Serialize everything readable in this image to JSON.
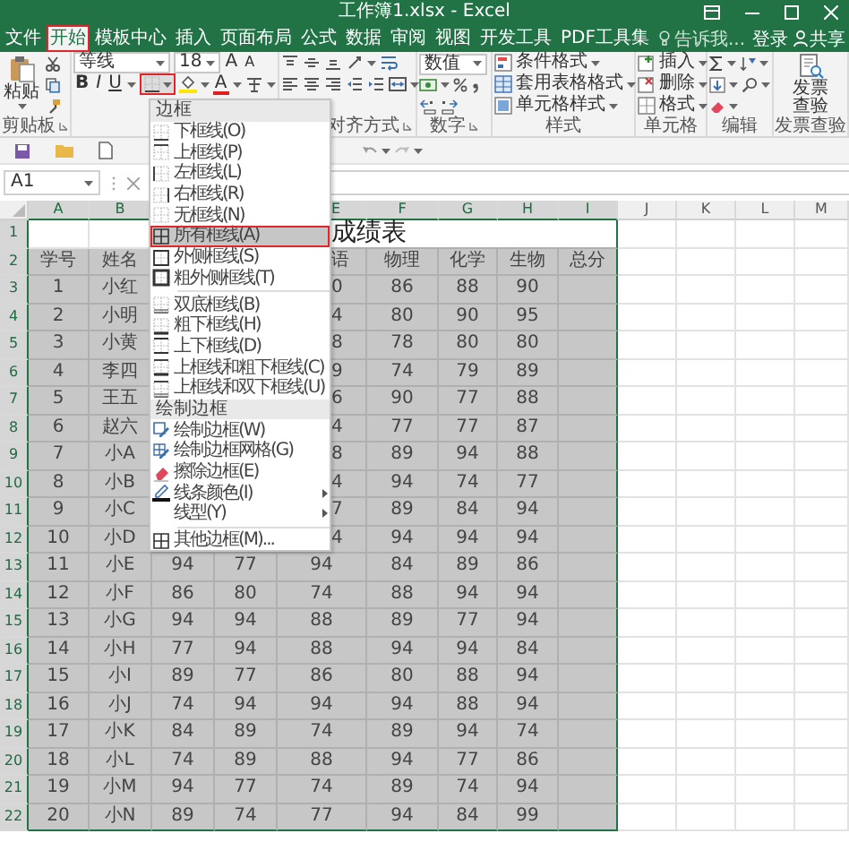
{
  "window": {
    "title": "工作簿1.xlsx - Excel"
  },
  "tabs": [
    {
      "label": "文件",
      "selected": false,
      "marked": false
    },
    {
      "label": "开始",
      "selected": true,
      "marked": true
    },
    {
      "label": "模板中心",
      "selected": false,
      "marked": false
    },
    {
      "label": "插入",
      "selected": false,
      "marked": false
    },
    {
      "label": "页面布局",
      "selected": false,
      "marked": false
    },
    {
      "label": "公式",
      "selected": false,
      "marked": false
    },
    {
      "label": "数据",
      "selected": false,
      "marked": false
    },
    {
      "label": "审阅",
      "selected": false,
      "marked": false
    },
    {
      "label": "视图",
      "selected": false,
      "marked": false
    },
    {
      "label": "开发工具",
      "selected": false,
      "marked": false
    },
    {
      "label": "PDF工具集",
      "selected": false,
      "marked": false
    }
  ],
  "tell_me": {
    "placeholder": "告诉我..."
  },
  "account": {
    "sign_in": "登录",
    "share": "共享"
  },
  "ribbon": {
    "clipboard": {
      "paste": "粘贴",
      "label": "剪贴板"
    },
    "font": {
      "name": "等线",
      "size": "18",
      "grow": "A",
      "shrink": "A",
      "bold": "B",
      "italic": "I",
      "underline": "U",
      "color_letter": "A",
      "borders_marked": true
    },
    "alignment": {
      "label": "对齐方式"
    },
    "number": {
      "format": "数值",
      "label": "数字"
    },
    "styles": {
      "items": [
        "条件格式",
        "套用表格格式",
        "单元格样式"
      ],
      "label": "样式"
    },
    "cells": {
      "items": [
        "插入",
        "删除",
        "格式"
      ],
      "label": "单元格"
    },
    "editing": {
      "label": "编辑"
    },
    "invoice": {
      "button": "发票查验",
      "label": "发票查验"
    }
  },
  "name_box": "A1",
  "border_menu": {
    "items": [
      {
        "kind": "header",
        "label": "边框"
      },
      {
        "kind": "item",
        "label": "下框线(O)",
        "highlighted": false,
        "marked": false,
        "submenu": false
      },
      {
        "kind": "item",
        "label": "上框线(P)",
        "highlighted": false,
        "marked": false,
        "submenu": false
      },
      {
        "kind": "item",
        "label": "左框线(L)",
        "highlighted": false,
        "marked": false,
        "submenu": false
      },
      {
        "kind": "item",
        "label": "右框线(R)",
        "highlighted": false,
        "marked": false,
        "submenu": false
      },
      {
        "kind": "item",
        "label": "无框线(N)",
        "highlighted": false,
        "marked": false,
        "submenu": false
      },
      {
        "kind": "item",
        "label": "所有框线(A)",
        "highlighted": true,
        "marked": true,
        "submenu": false
      },
      {
        "kind": "item",
        "label": "外侧框线(S)",
        "highlighted": false,
        "marked": false,
        "submenu": false
      },
      {
        "kind": "item",
        "label": "粗外侧框线(T)",
        "highlighted": false,
        "marked": false,
        "submenu": false
      },
      {
        "kind": "separator"
      },
      {
        "kind": "item",
        "label": "双底框线(B)",
        "highlighted": false,
        "marked": false,
        "submenu": false
      },
      {
        "kind": "item",
        "label": "粗下框线(H)",
        "highlighted": false,
        "marked": false,
        "submenu": false
      },
      {
        "kind": "item",
        "label": "上下框线(D)",
        "highlighted": false,
        "marked": false,
        "submenu": false
      },
      {
        "kind": "item",
        "label": "上框线和粗下框线(C)",
        "highlighted": false,
        "marked": false,
        "submenu": false
      },
      {
        "kind": "item",
        "label": "上框线和双下框线(U)",
        "highlighted": false,
        "marked": false,
        "submenu": false
      },
      {
        "kind": "header",
        "label": "绘制边框"
      },
      {
        "kind": "item",
        "label": "绘制边框(W)",
        "highlighted": false,
        "marked": false,
        "submenu": false
      },
      {
        "kind": "item",
        "label": "绘制边框网格(G)",
        "highlighted": false,
        "marked": false,
        "submenu": false
      },
      {
        "kind": "item",
        "label": "擦除边框(E)",
        "highlighted": false,
        "marked": false,
        "submenu": false
      },
      {
        "kind": "item",
        "label": "线条颜色(I)",
        "highlighted": false,
        "marked": false,
        "submenu": true
      },
      {
        "kind": "item",
        "label": "线型(Y)",
        "highlighted": false,
        "marked": false,
        "submenu": true
      },
      {
        "kind": "separator"
      },
      {
        "kind": "item",
        "label": "其他边框(M)...",
        "highlighted": false,
        "marked": false,
        "submenu": false
      }
    ]
  },
  "sheet": {
    "columns": [
      {
        "label": "A",
        "selected": true,
        "partial": false
      },
      {
        "label": "B",
        "selected": true,
        "partial": false
      },
      null,
      null,
      {
        "label": "E",
        "selected": true,
        "partial": true
      },
      {
        "label": "F",
        "selected": true,
        "partial": false
      },
      {
        "label": "G",
        "selected": true,
        "partial": false
      },
      {
        "label": "H",
        "selected": true,
        "partial": false
      },
      {
        "label": "I",
        "selected": true,
        "partial": false
      },
      {
        "label": "J",
        "selected": false,
        "partial": false
      },
      {
        "label": "K",
        "selected": false,
        "partial": false
      },
      {
        "label": "L",
        "selected": false,
        "partial": false
      },
      {
        "label": "M",
        "selected": false,
        "partial": false
      }
    ],
    "rows": [
      {
        "label": "1",
        "selected": true,
        "title": "成绩表"
      },
      {
        "label": "2",
        "selected": true,
        "e_cut": true,
        "cells": [
          "学号",
          "姓名",
          null,
          null,
          "语",
          "物理",
          "化学",
          "生物",
          "总分"
        ]
      },
      {
        "label": "3",
        "selected": true,
        "e_cut": true,
        "cells": [
          "1",
          "小红",
          null,
          null,
          "0",
          "86",
          "88",
          "90",
          null
        ]
      },
      {
        "label": "4",
        "selected": true,
        "e_cut": true,
        "cells": [
          "2",
          "小明",
          null,
          null,
          "4",
          "80",
          "90",
          "95",
          null
        ]
      },
      {
        "label": "5",
        "selected": true,
        "e_cut": true,
        "cells": [
          "3",
          "小黄",
          null,
          null,
          "8",
          "78",
          "80",
          "80",
          null
        ]
      },
      {
        "label": "6",
        "selected": true,
        "e_cut": true,
        "cells": [
          "4",
          "李四",
          null,
          null,
          "9",
          "74",
          "79",
          "89",
          null
        ]
      },
      {
        "label": "7",
        "selected": true,
        "e_cut": true,
        "cells": [
          "5",
          "王五",
          null,
          null,
          "6",
          "90",
          "77",
          "88",
          null
        ]
      },
      {
        "label": "8",
        "selected": true,
        "e_cut": true,
        "cells": [
          "6",
          "赵六",
          null,
          null,
          "4",
          "77",
          "77",
          "87",
          null
        ]
      },
      {
        "label": "9",
        "selected": true,
        "e_cut": true,
        "cells": [
          "7",
          "小A",
          null,
          null,
          "8",
          "89",
          "94",
          "88",
          null
        ]
      },
      {
        "label": "10",
        "selected": true,
        "e_cut": true,
        "cells": [
          "8",
          "小B",
          null,
          null,
          "4",
          "94",
          "74",
          "77",
          null
        ]
      },
      {
        "label": "11",
        "selected": true,
        "e_cut": true,
        "cells": [
          "9",
          "小C",
          null,
          null,
          "7",
          "89",
          "84",
          "94",
          null
        ]
      },
      {
        "label": "12",
        "selected": true,
        "e_cut": true,
        "cells": [
          "10",
          "小D",
          null,
          null,
          "4",
          "94",
          "94",
          "94",
          null
        ]
      },
      {
        "label": "13",
        "selected": true,
        "e_cut": false,
        "cells": [
          "11",
          "小E",
          "94",
          "77",
          "94",
          "84",
          "89",
          "86",
          null
        ]
      },
      {
        "label": "14",
        "selected": true,
        "e_cut": false,
        "cells": [
          "12",
          "小F",
          "86",
          "80",
          "74",
          "88",
          "94",
          "94",
          null
        ]
      },
      {
        "label": "15",
        "selected": true,
        "e_cut": false,
        "cells": [
          "13",
          "小G",
          "94",
          "94",
          "88",
          "89",
          "77",
          "94",
          null
        ]
      },
      {
        "label": "16",
        "selected": true,
        "e_cut": false,
        "cells": [
          "14",
          "小H",
          "77",
          "94",
          "88",
          "94",
          "94",
          "84",
          null
        ]
      },
      {
        "label": "17",
        "selected": true,
        "e_cut": false,
        "cells": [
          "15",
          "小I",
          "89",
          "77",
          "86",
          "80",
          "88",
          "94",
          null
        ]
      },
      {
        "label": "18",
        "selected": true,
        "e_cut": false,
        "cells": [
          "16",
          "小J",
          "74",
          "94",
          "94",
          "94",
          "88",
          "94",
          null
        ]
      },
      {
        "label": "19",
        "selected": true,
        "e_cut": false,
        "cells": [
          "17",
          "小K",
          "84",
          "89",
          "74",
          "89",
          "94",
          "74",
          null
        ]
      },
      {
        "label": "20",
        "selected": true,
        "e_cut": false,
        "cells": [
          "18",
          "小L",
          "74",
          "89",
          "88",
          "94",
          "77",
          "86",
          null
        ]
      },
      {
        "label": "21",
        "selected": true,
        "e_cut": false,
        "cells": [
          "19",
          "小M",
          "94",
          "77",
          "74",
          "89",
          "74",
          "94",
          null
        ]
      },
      {
        "label": "22",
        "selected": true,
        "e_cut": false,
        "cells": [
          "20",
          "小N",
          "89",
          "74",
          "77",
          "94",
          "84",
          "99",
          null
        ]
      }
    ]
  }
}
